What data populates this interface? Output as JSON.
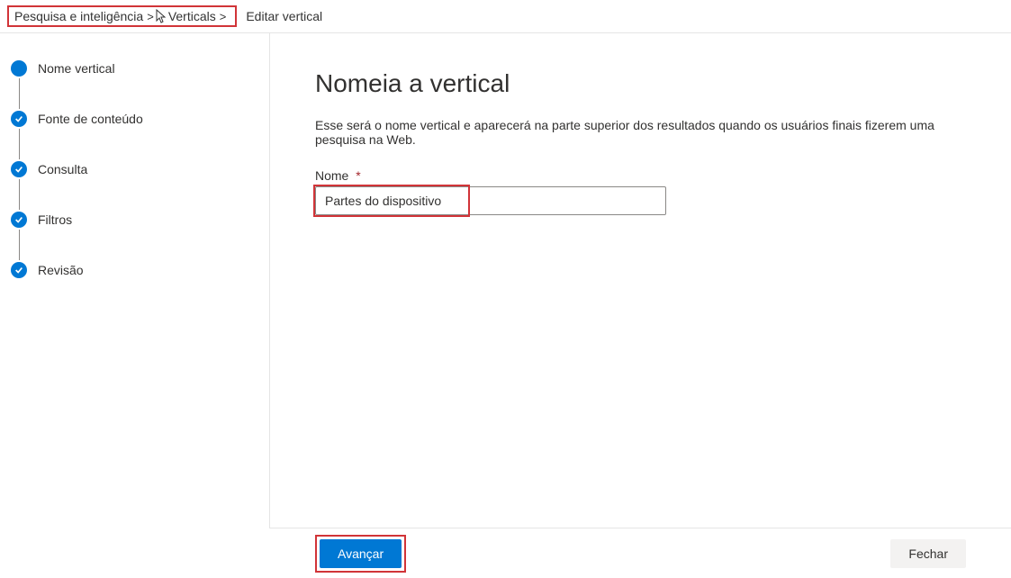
{
  "breadcrumb": {
    "segment1": "Pesquisa e inteligência",
    "segment2": "Verticals",
    "sep": "&gt;",
    "title": "Editar vertical"
  },
  "sidebar": {
    "steps": [
      {
        "label": "Nome vertical",
        "state": "current"
      },
      {
        "label": "Fonte de conteúdo",
        "state": "done"
      },
      {
        "label": "Consulta",
        "state": "done"
      },
      {
        "label": "Filtros",
        "state": "done"
      },
      {
        "label": "Revisão",
        "state": "done"
      }
    ]
  },
  "content": {
    "title": "Nomeia a vertical",
    "description": "Esse será o nome vertical e aparecerá na parte superior dos resultados quando os usuários finais fizerem uma pesquisa na Web.",
    "field_label": "Nome",
    "required_mark": "*",
    "field_value": "Partes do dispositivo"
  },
  "footer": {
    "primary": "Avançar",
    "secondary": "Fechar"
  }
}
